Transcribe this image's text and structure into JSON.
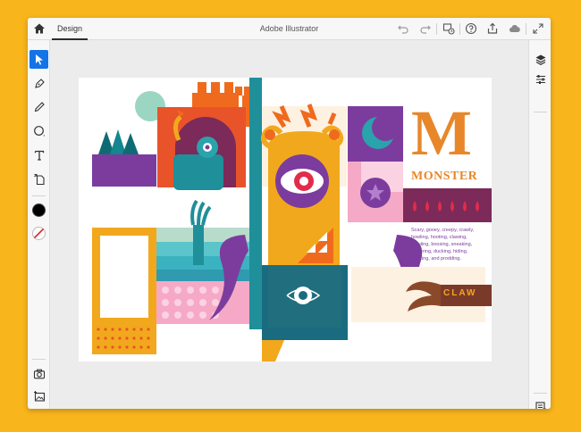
{
  "window": {
    "title": "Adobe Illustrator"
  },
  "tabs": [
    {
      "label": "Design"
    }
  ],
  "artwork": {
    "headline_letter": "M",
    "headline_word": "MONSTER",
    "body_copy_lines": [
      "Scary, gooey, creepy, crawly,",
      "howling, hooting, clawing,",
      "mauling, boosing, sneaking,",
      "slithering, ducking, hiding,",
      "peeking, and prodding."
    ],
    "claw_label": "CLAW"
  },
  "colors": {
    "background": "#f9b51c",
    "accent_blue": "#1473e6",
    "fill_color": "#000000",
    "stroke_color": "#ffffff",
    "art_orange": "#f06a1d",
    "art_purple": "#7c3c9e",
    "art_teal": "#1f8f9a",
    "art_yellow": "#f2a81d"
  }
}
